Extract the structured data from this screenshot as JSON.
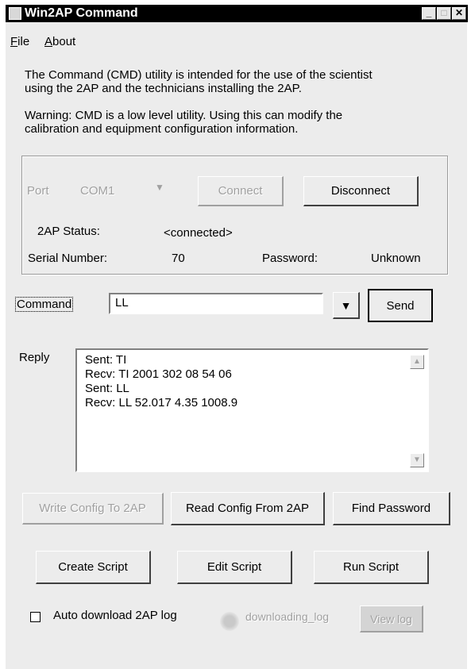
{
  "window": {
    "title": "Win2AP Command",
    "controls": {
      "minimize": "_",
      "maximize": "□",
      "close": "✕"
    }
  },
  "menu": [
    {
      "label": "File",
      "mnemonic": "F",
      "rest": "ile"
    },
    {
      "label": "About",
      "mnemonic": "A",
      "rest": "bout"
    }
  ],
  "intro": {
    "line1": "The Command (CMD) utility is intended for the use of the scientist",
    "line2": "using the 2AP and the technicians installing the 2AP.",
    "warning1": "Warning:  CMD is a low level utility.  Using this can modify the",
    "warning2": "calibration and equipment configuration information."
  },
  "connection": {
    "port_label": "Port",
    "port_value": "COM1",
    "connect_label": "Connect",
    "disconnect_label": "Disconnect",
    "status_label": "2AP Status:",
    "status_value": "<connected>",
    "serial_label": "Serial Number:",
    "serial_value": "70",
    "password_label": "Password:",
    "password_value": "Unknown"
  },
  "command": {
    "label": "Command",
    "value": "LL",
    "send_label": "Send"
  },
  "reply": {
    "label": "Reply",
    "lines": [
      "Sent: TI",
      "Recv: TI 2001  302  08 54 06",
      "Sent: LL",
      "Recv: LL 52.017 4.35 1008.9"
    ]
  },
  "config_buttons": {
    "write": "Write Config To 2AP",
    "read": "Read Config From 2AP",
    "find_password": "Find Password"
  },
  "script_buttons": {
    "create": "Create Script",
    "edit": "Edit Script",
    "run": "Run Script"
  },
  "log": {
    "auto_download_label": "Auto download 2AP log",
    "auto_download_checked": false,
    "downloading_label": "downloading_log",
    "view_log_label": "View log"
  }
}
